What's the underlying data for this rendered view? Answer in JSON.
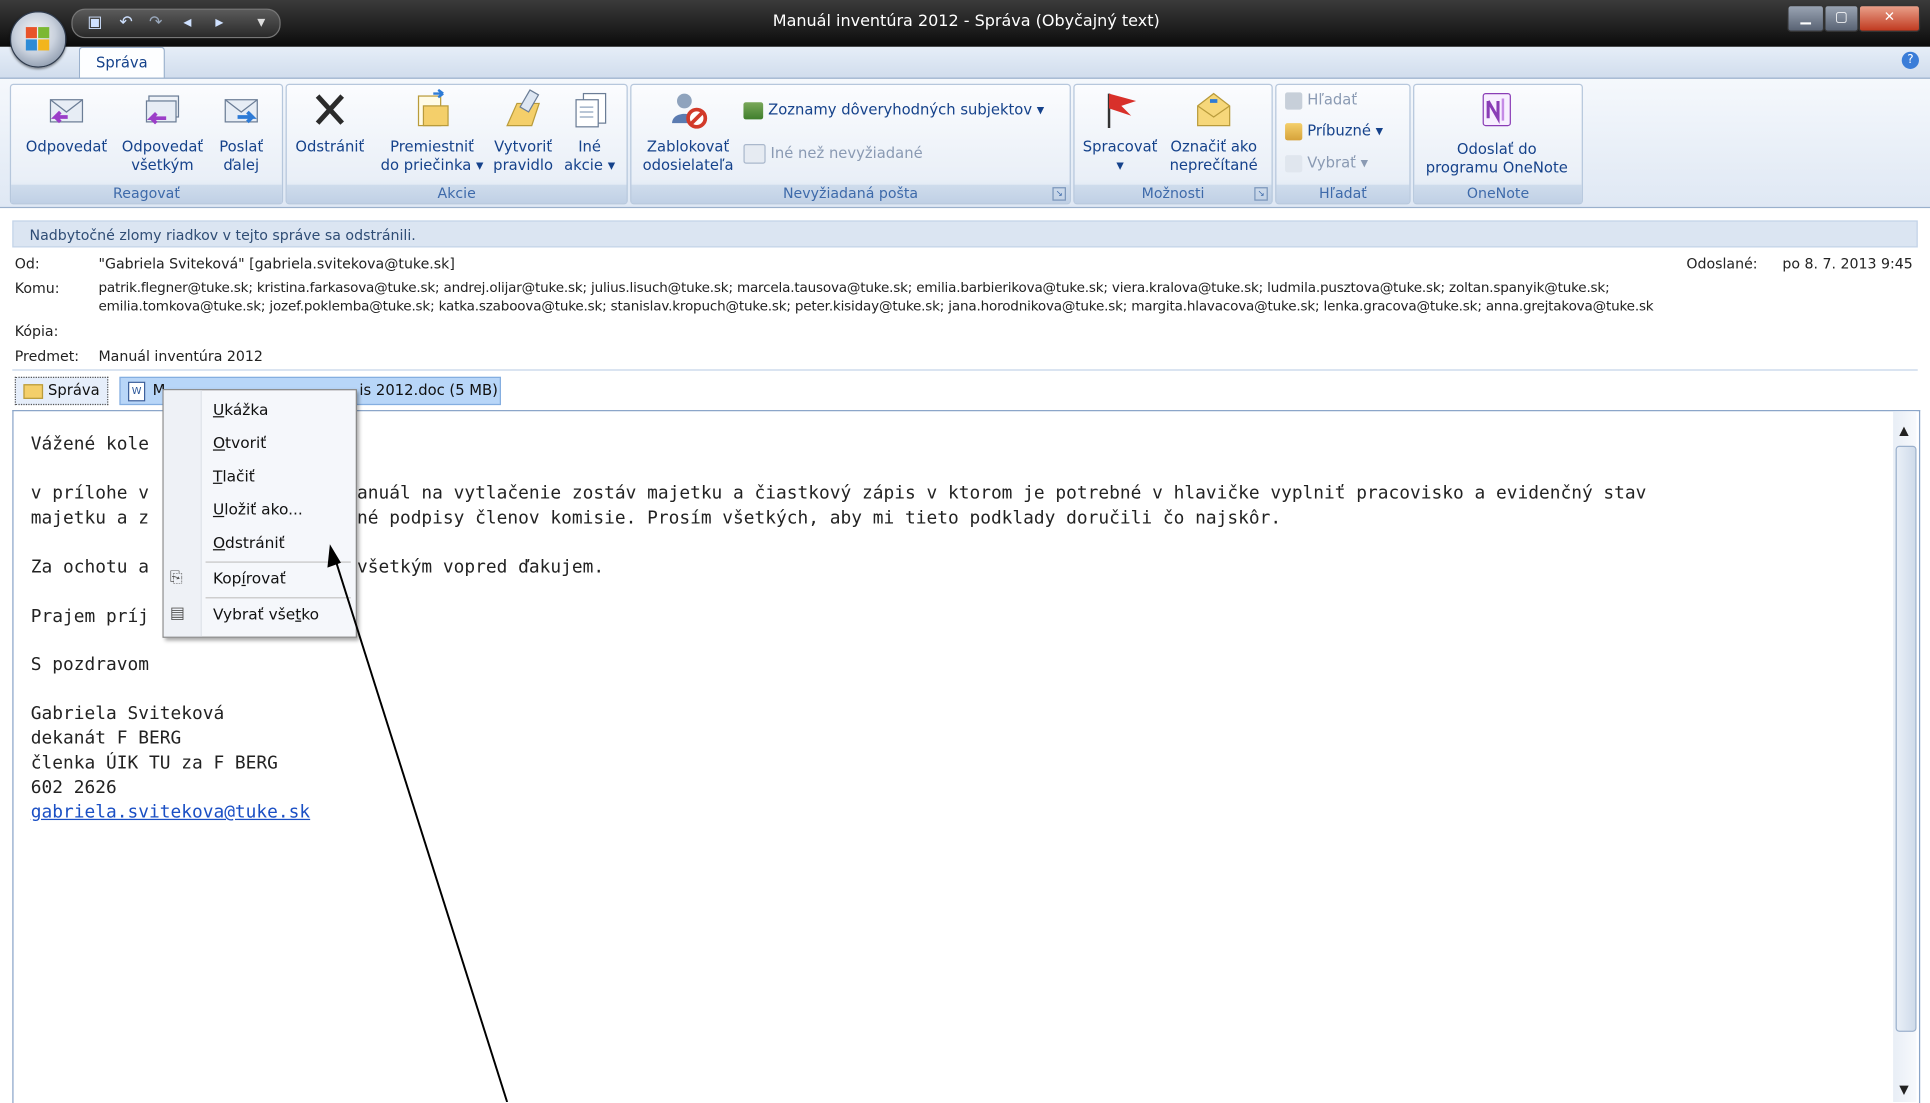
{
  "window": {
    "title": "Manuál inventúra 2012 - Správa (Obyčajný text)",
    "controls": [
      "minimize",
      "maximize",
      "close"
    ]
  },
  "ribbon": {
    "tab": "Správa",
    "groups": {
      "reagovat": {
        "label": "Reagovať",
        "reply": [
          "Odpovedať"
        ],
        "reply_all": [
          "Odpovedať",
          "všetkým"
        ],
        "forward": [
          "Poslať",
          "ďalej"
        ]
      },
      "akcie": {
        "label": "Akcie",
        "delete": [
          "Odstrániť"
        ],
        "move": [
          "Premiestniť",
          "do priečinka ▾"
        ],
        "create_rule": [
          "Vytvoriť",
          "pravidlo"
        ],
        "other": [
          "Iné",
          "akcie ▾"
        ]
      },
      "nevyziadana": {
        "label": "Nevyžiadaná pošta",
        "block": [
          "Zablokovať",
          "odosielateľa"
        ],
        "safe_lists": "Zoznamy dôveryhodných subjektov ▾",
        "not_junk": "Iné než nevyžiadané"
      },
      "moznosti": {
        "label": "Možnosti",
        "followup": [
          "Spracovať",
          "▾"
        ],
        "mark_unread": [
          "Označiť ako",
          "neprečítané"
        ]
      },
      "hladat": {
        "label": "Hľadať",
        "find": "Hľadať",
        "related": "Príbuzné ▾",
        "select": "Vybrať ▾"
      },
      "onenote": {
        "label": "OneNote",
        "send": [
          "Odoslať do",
          "programu OneNote"
        ]
      }
    }
  },
  "header": {
    "info": "Nadbytočné zlomy riadkov v tejto správe sa odstránili.",
    "from_label": "Od:",
    "from_value": "\"Gabriela Sviteková\" [gabriela.svitekova@tuke.sk]",
    "sent_label": "Odoslané:",
    "sent_value": "po 8. 7. 2013 9:45",
    "to_label": "Komu:",
    "to_line1": "patrik.flegner@tuke.sk; kristina.farkasova@tuke.sk; andrej.olijar@tuke.sk; julius.lisuch@tuke.sk; marcela.tausova@tuke.sk; emilia.barbierikova@tuke.sk; viera.kralova@tuke.sk; ludmila.pusztova@tuke.sk; zoltan.spanyik@tuke.sk;",
    "to_line2": "emilia.tomkova@tuke.sk; jozef.poklemba@tuke.sk; katka.szaboova@tuke.sk; stanislav.kropuch@tuke.sk; peter.kisiday@tuke.sk; jana.horodnikova@tuke.sk; margita.hlavacova@tuke.sk; lenka.gracova@tuke.sk; anna.grejtakova@tuke.sk",
    "cc_label": "Kópia:",
    "subject_label": "Predmet:",
    "subject_value": "Manuál inventúra 2012"
  },
  "attachments": {
    "message_tab": "Správa",
    "file_visible_prefix": "M",
    "file_visible_suffix": "is 2012.doc (5 MB)"
  },
  "context_menu": {
    "items": [
      {
        "label": "Ukážka",
        "accel": "U",
        "rest": "kážka"
      },
      {
        "label": "Otvoriť",
        "accel": "O",
        "rest": "tvoriť"
      },
      {
        "label": "Tlačiť",
        "accel": "T",
        "rest": "lačiť"
      },
      {
        "label": "Uložiť ako...",
        "accel": "U",
        "rest": "ložiť ako..."
      },
      {
        "label": "Odstrániť",
        "accel": "O",
        "rest": "dstrániť"
      },
      {
        "label": "Kopírovať",
        "pre": "Kop",
        "accel": "í",
        "rest": "rovať"
      },
      {
        "label": "Vybrať všetko",
        "pre": "Vybrať vše",
        "accel": "t",
        "rest": "ko"
      }
    ]
  },
  "body": {
    "greeting_visible": "Vážené kole",
    "p1_line1_left": "v prílohe v",
    "p1_line1_right": "anuál na vytlačenie zostáv majetku a čiastkový zápis v ktorom je potrebné v hlavičke vyplniť pracovisko a evidenčný stav",
    "p1_line2_left": "majetku a z",
    "p1_line2_right": "né podpisy členov komisie. Prosím všetkých, aby mi tieto podklady doručili čo najskôr.",
    "thanks_left": "Za ochotu a",
    "thanks_right": "všetkým vopred ďakujem.",
    "wish_visible": "Prajem príj",
    "closing": "S pozdravom",
    "sig_name": "Gabriela Sviteková",
    "sig_line2": "dekanát F BERG",
    "sig_line3": "členka ÚIK TU za F BERG",
    "sig_phone": "602 2626",
    "sig_email": "gabriela.svitekova@tuke.sk"
  },
  "colors": {
    "ribbon_text": "#15428b",
    "group_label": "#3e6aaa",
    "link": "#1a4fc4",
    "info_bar": "#dbe5f2",
    "attachment_selected": "#b8d6f8"
  }
}
